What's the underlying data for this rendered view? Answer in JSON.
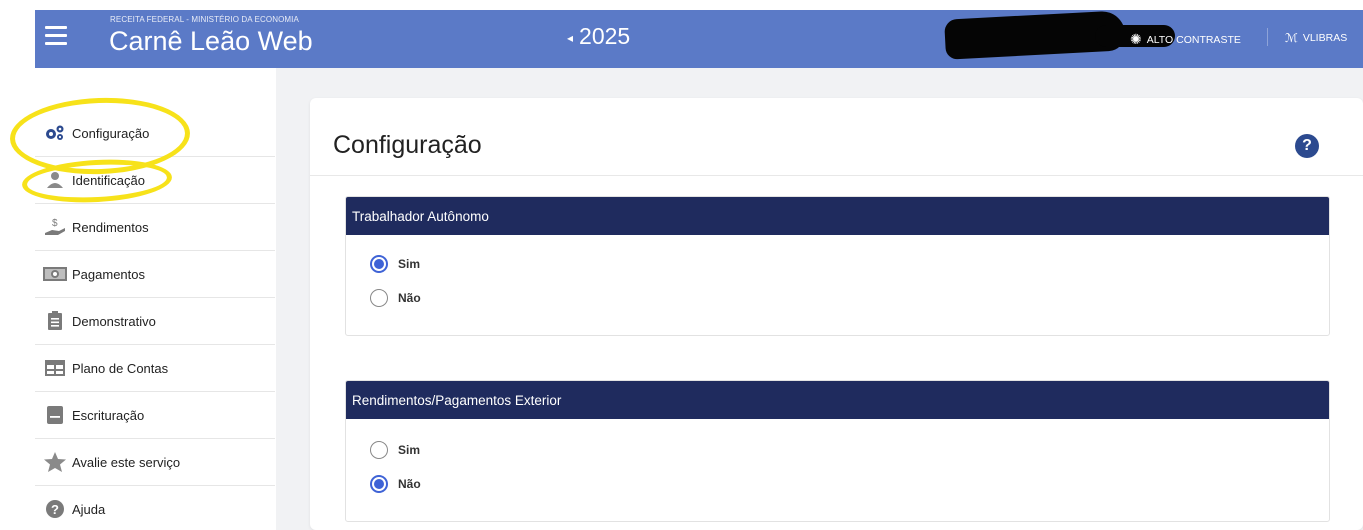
{
  "header": {
    "gov_line": "RECEITA FEDERAL - MINISTÉRIO DA ECONOMIA",
    "app_title": "Carnê Leão Web",
    "year_caret": "◂",
    "year": "2025",
    "high_contrast_icon": "✺",
    "high_contrast_label": "ALTO CONTRASTE",
    "libras_icon": "ℳ",
    "libras_label": "VLIBRAS"
  },
  "sidebar": {
    "items": [
      {
        "label": "Configuração",
        "icon": "gears-icon",
        "color": "#2c4a8f"
      },
      {
        "label": "Identificação",
        "icon": "person-icon",
        "color": "#7a7a7a"
      },
      {
        "label": "Rendimentos",
        "icon": "money-hand-icon",
        "color": "#7a7a7a"
      },
      {
        "label": "Pagamentos",
        "icon": "banknote-icon",
        "color": "#7a7a7a"
      },
      {
        "label": "Demonstrativo",
        "icon": "clipboard-icon",
        "color": "#7a7a7a"
      },
      {
        "label": "Plano de Contas",
        "icon": "table-icon",
        "color": "#7a7a7a"
      },
      {
        "label": "Escrituração",
        "icon": "ledger-icon",
        "color": "#7a7a7a"
      },
      {
        "label": "Avalie este serviço",
        "icon": "star-icon",
        "color": "#7a7a7a"
      },
      {
        "label": "Ajuda",
        "icon": "help-circle-icon",
        "color": "#7a7a7a"
      }
    ]
  },
  "main": {
    "title": "Configuração",
    "help": "?",
    "panels": [
      {
        "title": "Trabalhador Autônomo",
        "options": [
          {
            "label": "Sim",
            "checked": true
          },
          {
            "label": "Não",
            "checked": false
          }
        ]
      },
      {
        "title": "Rendimentos/Pagamentos Exterior",
        "options": [
          {
            "label": "Sim",
            "checked": false
          },
          {
            "label": "Não",
            "checked": true
          }
        ]
      }
    ]
  },
  "colors": {
    "header_bg": "#5b7ac7",
    "panel_header_bg": "#1f2b5e",
    "radio_accent": "#3f63d6",
    "highlight": "#f7e21a"
  }
}
